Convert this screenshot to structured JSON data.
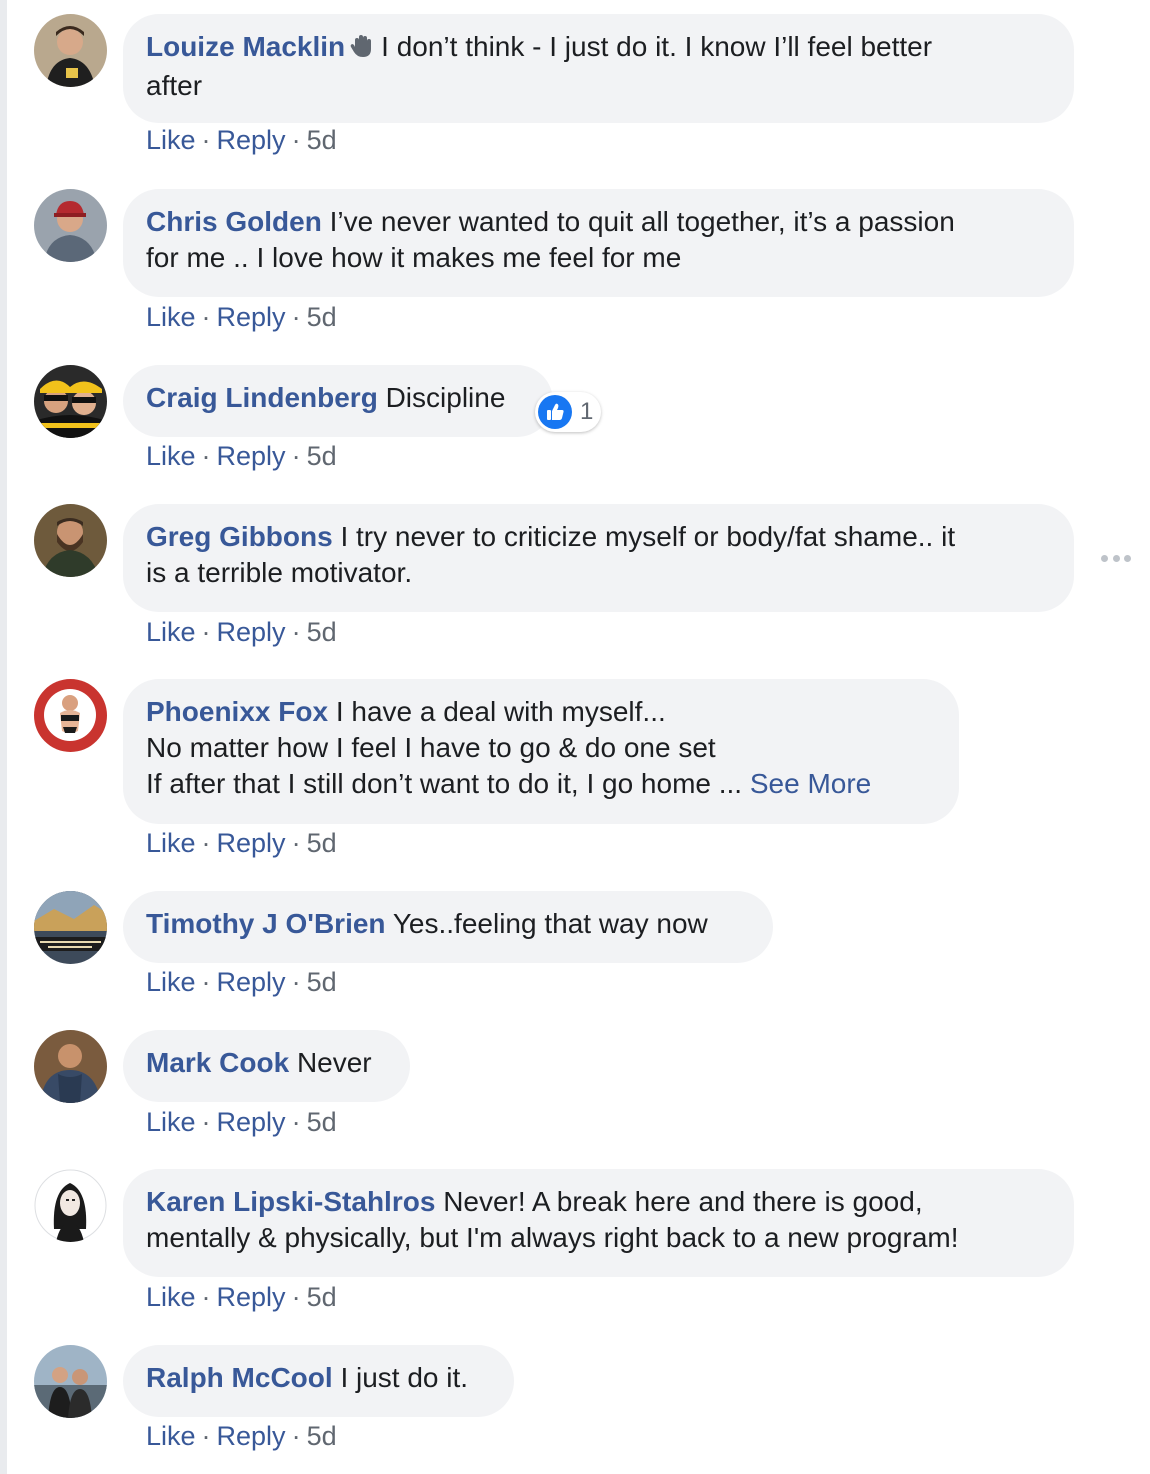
{
  "actions": {
    "like": "Like",
    "reply": "Reply",
    "sep": "·"
  },
  "comments": [
    {
      "author": "Louize Macklin",
      "text": "I don’t think - I just do it. I know I’ll feel better\nafter",
      "time": "5d"
    },
    {
      "author": "Chris Golden",
      "text": "I’ve never wanted to quit all together, it’s a passion\nfor me .. I love how it makes me feel for me",
      "time": "5d"
    },
    {
      "author": "Craig Lindenberg",
      "text": "Discipline",
      "time": "5d",
      "reaction_count": "1"
    },
    {
      "author": "Greg Gibbons",
      "text": "I try never to criticize myself or body/fat shame.. it\nis a terrible motivator.",
      "time": "5d"
    },
    {
      "author": "Phoenixx Fox",
      "text": "I have a deal with myself...\nNo matter how I feel I have to go & do one set\nIf after that I still don’t want to do it, I go home ... ",
      "see_more": "See More",
      "time": "5d"
    },
    {
      "author": "Timothy J O'Brien",
      "text": "Yes..feeling that way now",
      "time": "5d"
    },
    {
      "author": "Mark Cook",
      "text": "Never",
      "time": "5d"
    },
    {
      "author": "Karen Lipski-Stahlros",
      "text": "Never! A break here and there is good,\nmentally & physically, but I'm always right back to a new program!",
      "time": "5d"
    },
    {
      "author": "Ralph McCool",
      "text": "I just do it.",
      "time": "5d"
    }
  ],
  "colors": {
    "link": "#385898",
    "bubble": "#f2f3f5",
    "meta": "#606770",
    "like_blue": "#1877f2"
  }
}
